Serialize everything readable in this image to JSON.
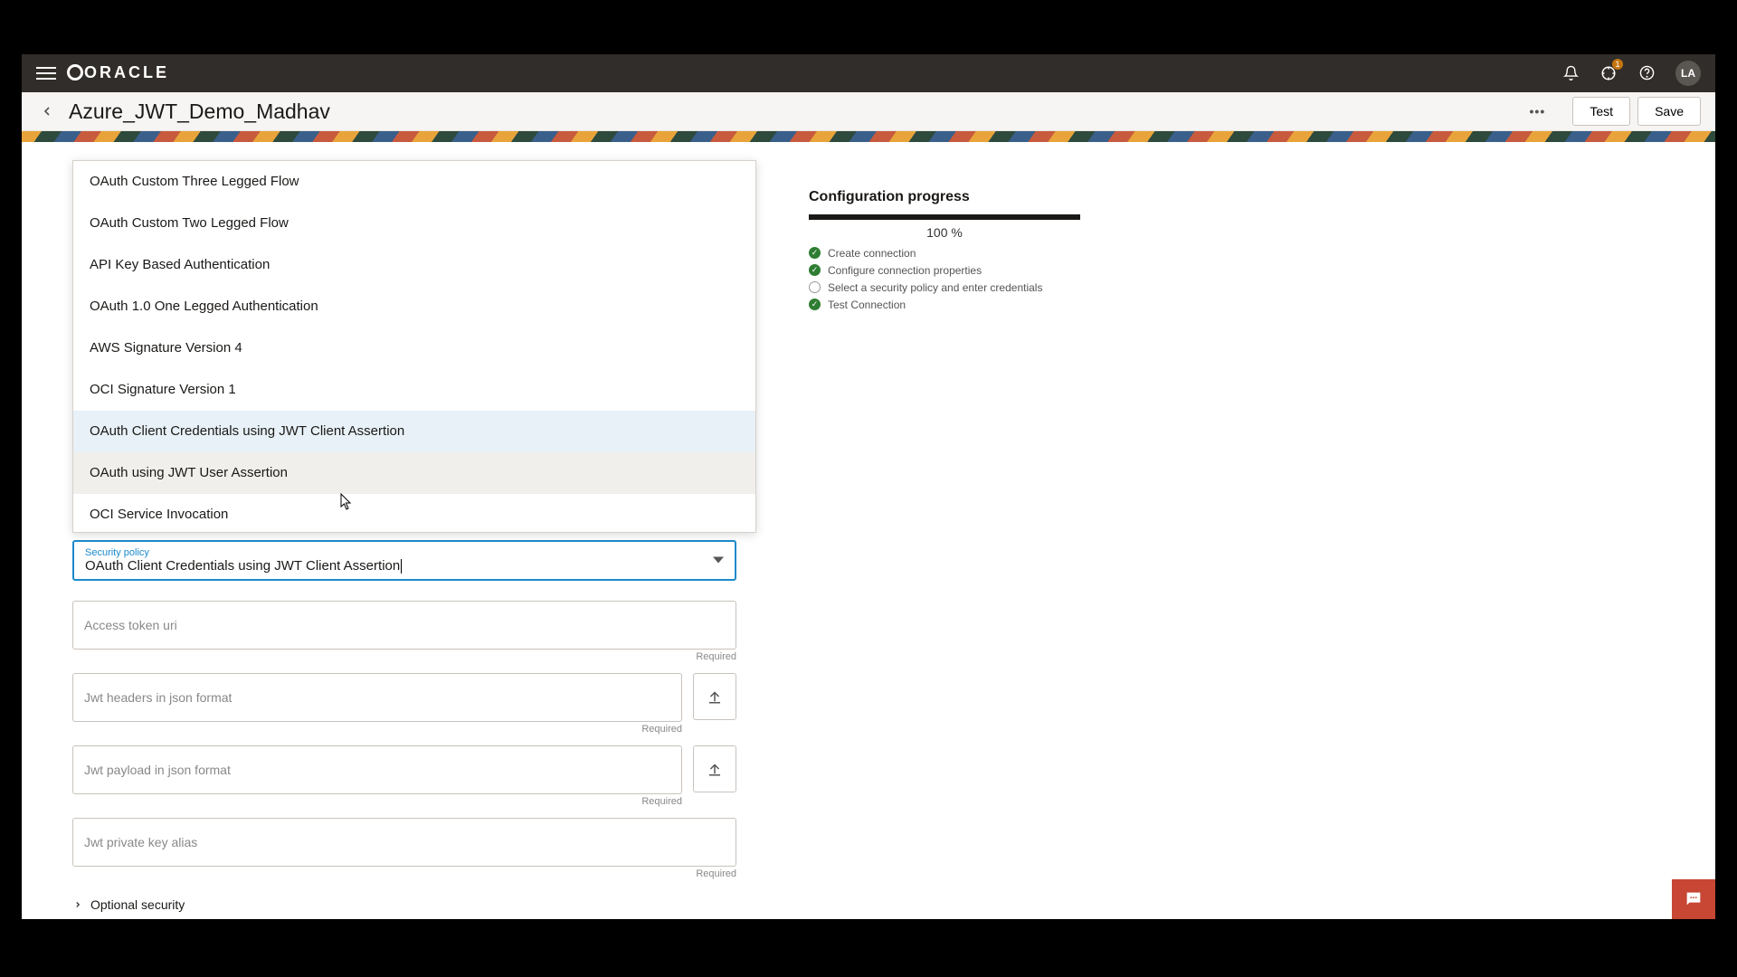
{
  "brand": "ORACLE",
  "notification_badge": "1",
  "avatar_initials": "LA",
  "page_title": "Azure_JWT_Demo_Madhav",
  "buttons": {
    "test": "Test",
    "save": "Save"
  },
  "dropdown_options": [
    "OAuth Custom Three Legged Flow",
    "OAuth Custom Two Legged Flow",
    "API Key Based Authentication",
    "OAuth 1.0 One Legged Authentication",
    "AWS Signature Version 4",
    "OCI Signature Version 1",
    "OAuth Client Credentials using JWT Client Assertion",
    "OAuth using JWT User Assertion",
    "OCI Service Invocation"
  ],
  "selected_index": 6,
  "hovered_index": 7,
  "security_policy_label": "Security policy",
  "security_policy_value": "OAuth Client Credentials using JWT Client Assertion",
  "fields": {
    "access_token_uri": "Access token uri",
    "jwt_headers": "Jwt headers in json format",
    "jwt_payload": "Jwt payload in json format",
    "jwt_private_key": "Jwt private key alias"
  },
  "required_label": "Required",
  "optional_security": "Optional security",
  "progress": {
    "title": "Configuration progress",
    "percent": 100,
    "percent_label": "100 %",
    "steps": [
      {
        "label": "Create connection",
        "done": true
      },
      {
        "label": "Configure connection properties",
        "done": true
      },
      {
        "label": "Select a security policy and enter credentials",
        "done": false
      },
      {
        "label": "Test Connection",
        "done": true
      }
    ]
  }
}
